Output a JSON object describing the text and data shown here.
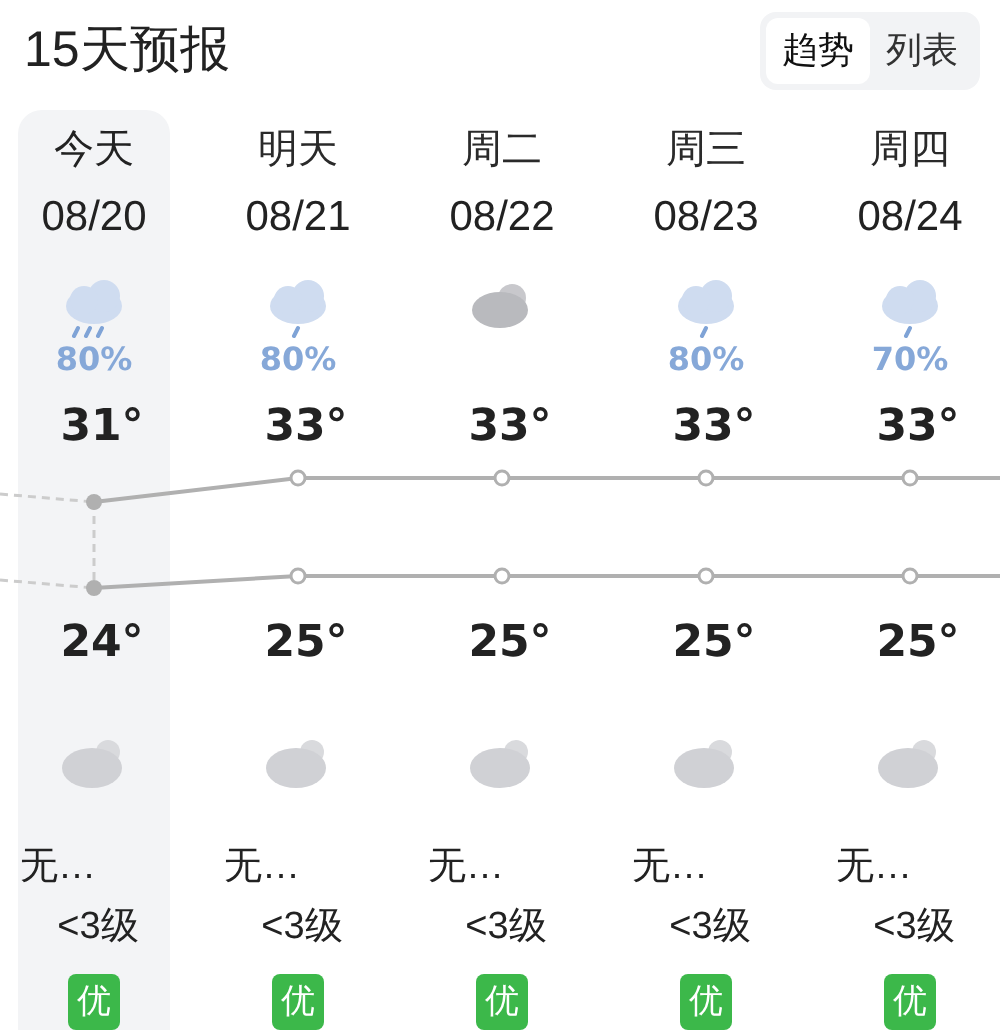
{
  "title": "15天预报",
  "view_toggle": [
    {
      "label": "趋势",
      "selected": true
    },
    {
      "label": "列表",
      "selected": false
    }
  ],
  "days": [
    {
      "label": "今天",
      "date": "08/20",
      "selected": true,
      "day_icon": {
        "kind": "light_rain"
      },
      "precip": "80%",
      "high": "31°",
      "low": "24°",
      "night_icon": {
        "kind": "cloudy_night"
      },
      "wind_dir": "无…",
      "wind_level": "<3级",
      "aqi": "优"
    },
    {
      "label": "明天",
      "date": "08/21",
      "selected": false,
      "day_icon": {
        "kind": "rain"
      },
      "precip": "80%",
      "high": "33°",
      "low": "25°",
      "night_icon": {
        "kind": "cloudy_night"
      },
      "wind_dir": "无…",
      "wind_level": "<3级",
      "aqi": "优"
    },
    {
      "label": "周二",
      "date": "08/22",
      "selected": false,
      "day_icon": {
        "kind": "cloudy"
      },
      "high": "33°",
      "low": "25°",
      "night_icon": {
        "kind": "cloudy_night"
      },
      "wind_dir": "无…",
      "wind_level": "<3级",
      "aqi": "优"
    },
    {
      "label": "周三",
      "date": "08/23",
      "selected": false,
      "day_icon": {
        "kind": "rain"
      },
      "precip": "80%",
      "high": "33°",
      "low": "25°",
      "night_icon": {
        "kind": "cloudy_night"
      },
      "wind_dir": "无…",
      "wind_level": "<3级",
      "aqi": "优"
    },
    {
      "label": "周四",
      "date": "08/24",
      "selected": false,
      "day_icon": {
        "kind": "rain"
      },
      "precip": "70%",
      "high": "33°",
      "low": "25°",
      "night_icon": {
        "kind": "cloudy_night"
      },
      "wind_dir": "无…",
      "wind_level": "<3级",
      "aqi": "优"
    }
  ]
}
